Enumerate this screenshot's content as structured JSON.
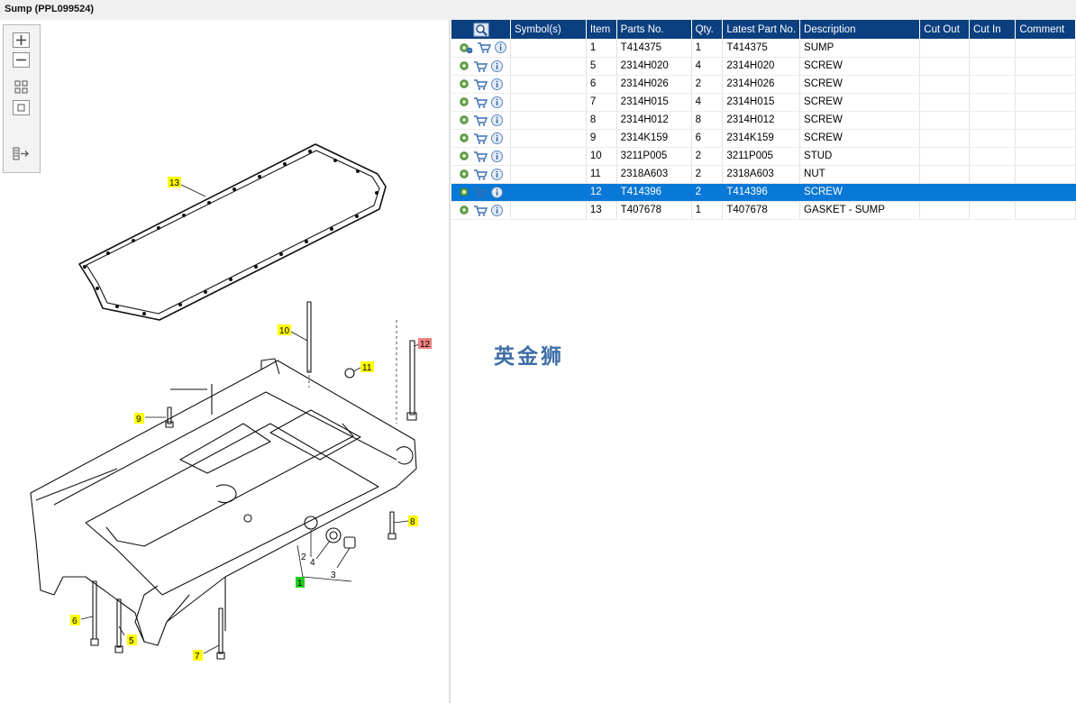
{
  "window": {
    "title": "Sump (PPL099524)"
  },
  "toolbar": {
    "buttons": [
      {
        "name": "zoom-in",
        "icon": "plus-icon"
      },
      {
        "name": "zoom-out",
        "icon": "minus-icon"
      },
      {
        "name": "fit-all",
        "icon": "grid-icon"
      },
      {
        "name": "fit-window",
        "icon": "square-icon"
      },
      {
        "name": "export",
        "icon": "export-icon"
      }
    ]
  },
  "diagram": {
    "callouts": [
      "13",
      "10",
      "11",
      "12",
      "9",
      "8",
      "6",
      "5",
      "7",
      "1",
      "2",
      "4",
      "3"
    ]
  },
  "table": {
    "headers": {
      "symbols": "Symbol(s)",
      "item": "Item",
      "part_no": "Parts No.",
      "qty": "Qty.",
      "latest": "Latest Part No.",
      "description": "Description",
      "cut_out": "Cut Out",
      "cut_in": "Cut In",
      "comment": "Comment"
    },
    "rows": [
      {
        "item": "1",
        "part_no": "T414375",
        "qty": "1",
        "latest": "T414375",
        "description": "SUMP"
      },
      {
        "item": "5",
        "part_no": "2314H020",
        "qty": "4",
        "latest": "2314H020",
        "description": "SCREW"
      },
      {
        "item": "6",
        "part_no": "2314H026",
        "qty": "2",
        "latest": "2314H026",
        "description": "SCREW"
      },
      {
        "item": "7",
        "part_no": "2314H015",
        "qty": "4",
        "latest": "2314H015",
        "description": "SCREW"
      },
      {
        "item": "8",
        "part_no": "2314H012",
        "qty": "8",
        "latest": "2314H012",
        "description": "SCREW"
      },
      {
        "item": "9",
        "part_no": "2314K159",
        "qty": "6",
        "latest": "2314K159",
        "description": "SCREW"
      },
      {
        "item": "10",
        "part_no": "3211P005",
        "qty": "2",
        "latest": "3211P005",
        "description": "STUD"
      },
      {
        "item": "11",
        "part_no": "2318A603",
        "qty": "2",
        "latest": "2318A603",
        "description": "NUT"
      },
      {
        "item": "12",
        "part_no": "T414396",
        "qty": "2",
        "latest": "T414396",
        "description": "SCREW"
      },
      {
        "item": "13",
        "part_no": "T407678",
        "qty": "1",
        "latest": "T407678",
        "description": "GASKET - SUMP"
      }
    ],
    "selected_item": "12"
  },
  "watermark": "英金狮",
  "colors": {
    "header_bg": "#0b3f80",
    "selected_row": "#0a78d6",
    "callout_yellow": "#ffff00",
    "callout_red": "#f08080",
    "callout_green": "#22cc22"
  }
}
